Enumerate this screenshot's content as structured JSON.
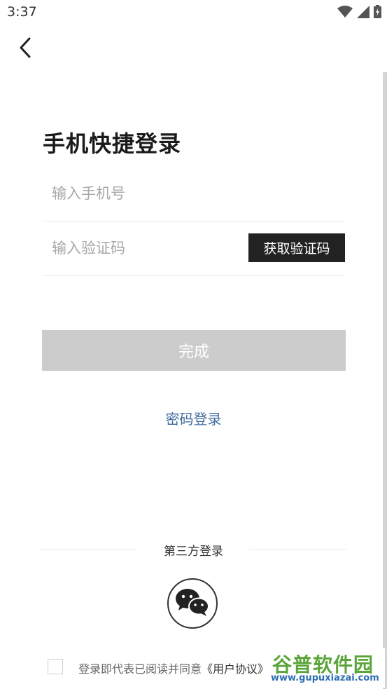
{
  "status_bar": {
    "time": "3:37",
    "icons": [
      "wifi-icon",
      "signal-icon",
      "battery-charging-icon"
    ]
  },
  "nav": {
    "back_icon": "chevron-left-icon"
  },
  "page": {
    "title": "手机快捷登录"
  },
  "form": {
    "phone_placeholder": "输入手机号",
    "phone_value": "",
    "code_placeholder": "输入验证码",
    "code_value": "",
    "get_code_label": "获取验证码",
    "submit_label": "完成"
  },
  "links": {
    "password_login": "密码登录"
  },
  "third_party": {
    "label": "第三方登录",
    "wechat_icon": "wechat-icon"
  },
  "agreement": {
    "checked": false,
    "text_prefix": "登录即代表已阅读并同意",
    "link": "《用户协议》"
  },
  "watermark": {
    "title": "谷普软件园",
    "url": "www.gupuxiazai.com"
  },
  "colors": {
    "get_code_button_bg": "#222222",
    "submit_button_disabled_bg": "#cccccc",
    "link_blue": "#3f6a9e",
    "divider": "#ececec",
    "scroll_indicator": "#d4d4d4"
  }
}
